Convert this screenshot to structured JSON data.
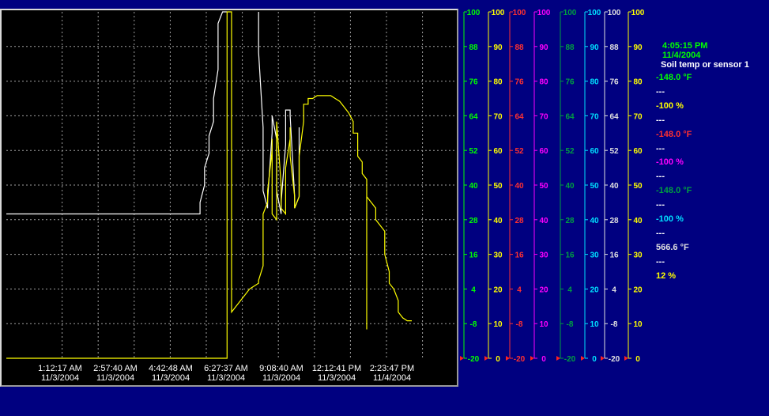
{
  "clock": {
    "time": "4:05:15 PM",
    "date": "11/4/2004",
    "sensor": "Soil temp or sensor 1"
  },
  "readings": [
    {
      "value": "-148.0 °F",
      "color": "#00ff00"
    },
    {
      "value": "---",
      "color": "#ffffff"
    },
    {
      "value": "-100 %",
      "color": "#ffff00"
    },
    {
      "value": "---",
      "color": "#ffffff"
    },
    {
      "value": "-148.0 °F",
      "color": "#ff3030"
    },
    {
      "value": "---",
      "color": "#ffffff"
    },
    {
      "value": "-100 %",
      "color": "#ff00ff"
    },
    {
      "value": "---",
      "color": "#ffffff"
    },
    {
      "value": "-148.0 °F",
      "color": "#00a040"
    },
    {
      "value": "---",
      "color": "#ffffff"
    },
    {
      "value": "-100 %",
      "color": "#00e0ff"
    },
    {
      "value": "---",
      "color": "#ffffff"
    },
    {
      "value": "566.6 °F",
      "color": "#e0e0e0"
    },
    {
      "value": "---",
      "color": "#ffffff"
    },
    {
      "value": "12 %",
      "color": "#ffff00"
    }
  ],
  "x_axis": [
    {
      "time": "1:12:17 AM",
      "date": "11/3/2004"
    },
    {
      "time": "2:57:40 AM",
      "date": "11/3/2004"
    },
    {
      "time": "4:42:48 AM",
      "date": "11/3/2004"
    },
    {
      "time": "6:27:37 AM",
      "date": "11/3/2004"
    },
    {
      "time": "9:08:40 AM",
      "date": "11/3/2004"
    },
    {
      "time": "12:12:41 PM",
      "date": "11/3/2004"
    },
    {
      "time": "2:23:47 PM",
      "date": "11/4/2004"
    }
  ],
  "axes": [
    {
      "color": "#00ff00",
      "labels": [
        "100",
        "88",
        "76",
        "64",
        "52",
        "40",
        "28",
        "16",
        "4",
        "-8",
        "-20"
      ]
    },
    {
      "color": "#ffff00",
      "labels": [
        "100",
        "90",
        "80",
        "70",
        "60",
        "50",
        "40",
        "30",
        "20",
        "10",
        "0"
      ]
    },
    {
      "color": "#ff3030",
      "labels": [
        "100",
        "88",
        "76",
        "64",
        "52",
        "40",
        "28",
        "16",
        "4",
        "-8",
        "-20"
      ]
    },
    {
      "color": "#ff00ff",
      "labels": [
        "100",
        "90",
        "80",
        "70",
        "60",
        "50",
        "40",
        "30",
        "20",
        "10",
        "0"
      ]
    },
    {
      "color": "#00a040",
      "labels": [
        "100",
        "88",
        "76",
        "64",
        "52",
        "40",
        "28",
        "16",
        "4",
        "-8",
        "-20"
      ]
    },
    {
      "color": "#00e0ff",
      "labels": [
        "100",
        "90",
        "80",
        "70",
        "60",
        "50",
        "40",
        "30",
        "20",
        "10",
        "0"
      ]
    },
    {
      "color": "#e0e0e0",
      "labels": [
        "100",
        "88",
        "76",
        "64",
        "52",
        "40",
        "28",
        "16",
        "4",
        "-8",
        "-20"
      ]
    },
    {
      "color": "#ffff00",
      "labels": [
        "100",
        "90",
        "80",
        "70",
        "60",
        "50",
        "40",
        "30",
        "20",
        "10",
        "0"
      ]
    }
  ],
  "chart_data": {
    "type": "line",
    "y_axis_range": [
      -20,
      100
    ],
    "series": [
      {
        "color": "#ffffff",
        "points": [
          [
            0,
            30
          ],
          [
            43,
            30
          ],
          [
            43,
            34
          ],
          [
            44,
            40
          ],
          [
            44,
            46
          ],
          [
            45,
            51
          ],
          [
            45,
            57
          ],
          [
            46,
            62
          ],
          [
            46,
            70
          ],
          [
            47,
            80
          ],
          [
            47,
            88
          ],
          [
            47,
            96
          ],
          [
            48,
            100
          ],
          [
            49,
            100
          ]
        ]
      },
      {
        "color": "#ffffff",
        "points": [
          [
            56,
            100
          ],
          [
            56,
            86
          ],
          [
            57,
            60
          ],
          [
            57,
            38
          ],
          [
            58,
            32
          ],
          [
            58,
            35
          ],
          [
            59,
            58
          ],
          [
            59,
            64
          ],
          [
            60,
            56
          ],
          [
            60,
            38
          ],
          [
            61,
            30
          ],
          [
            61,
            34
          ],
          [
            62,
            54
          ],
          [
            62,
            66
          ],
          [
            63,
            66
          ],
          [
            63,
            64
          ],
          [
            64,
            36
          ],
          [
            64,
            32
          ],
          [
            65,
            36
          ],
          [
            65,
            60
          ]
        ]
      },
      {
        "color": "#ffff00",
        "points": [
          [
            0,
            -20
          ],
          [
            49,
            -20
          ],
          [
            49,
            100
          ],
          [
            50,
            100
          ],
          [
            50,
            -4
          ],
          [
            51,
            -2
          ],
          [
            52,
            0
          ],
          [
            53,
            2
          ],
          [
            54,
            4
          ],
          [
            55,
            5
          ],
          [
            56,
            6
          ],
          [
            56,
            7
          ],
          [
            57,
            12
          ],
          [
            57,
            20
          ],
          [
            57,
            30
          ],
          [
            58,
            34
          ],
          [
            58,
            38
          ],
          [
            59,
            52
          ],
          [
            59,
            56
          ],
          [
            59,
            30
          ],
          [
            60,
            28
          ],
          [
            60,
            58
          ],
          [
            60,
            30
          ],
          [
            60,
            62
          ],
          [
            61,
            40
          ],
          [
            61,
            32
          ],
          [
            62,
            30
          ],
          [
            62,
            46
          ],
          [
            63,
            56
          ],
          [
            63,
            60
          ],
          [
            63,
            50
          ],
          [
            64,
            36
          ],
          [
            64,
            32
          ],
          [
            65,
            36
          ],
          [
            65,
            50
          ],
          [
            66,
            62
          ],
          [
            66,
            68
          ],
          [
            67,
            68
          ],
          [
            67,
            70
          ],
          [
            68,
            70
          ],
          [
            69,
            71
          ],
          [
            70,
            71
          ],
          [
            72,
            71
          ],
          [
            73,
            70
          ],
          [
            74,
            69
          ],
          [
            75,
            67
          ],
          [
            76,
            65
          ],
          [
            77,
            62
          ],
          [
            77,
            58
          ],
          [
            78,
            58
          ],
          [
            78,
            50
          ],
          [
            79,
            48
          ],
          [
            79,
            44
          ],
          [
            80,
            42
          ],
          [
            80,
            36
          ],
          [
            80,
            16
          ],
          [
            80,
            -10
          ],
          [
            80,
            20
          ],
          [
            80,
            36
          ],
          [
            81,
            34
          ],
          [
            82,
            32
          ],
          [
            82,
            28
          ],
          [
            83,
            26
          ],
          [
            84,
            24
          ],
          [
            84,
            16
          ],
          [
            85,
            10
          ],
          [
            85,
            6
          ],
          [
            86,
            4
          ],
          [
            87,
            0
          ],
          [
            87,
            -4
          ],
          [
            88,
            -6
          ],
          [
            89,
            -7
          ],
          [
            90,
            -7
          ]
        ]
      }
    ]
  }
}
